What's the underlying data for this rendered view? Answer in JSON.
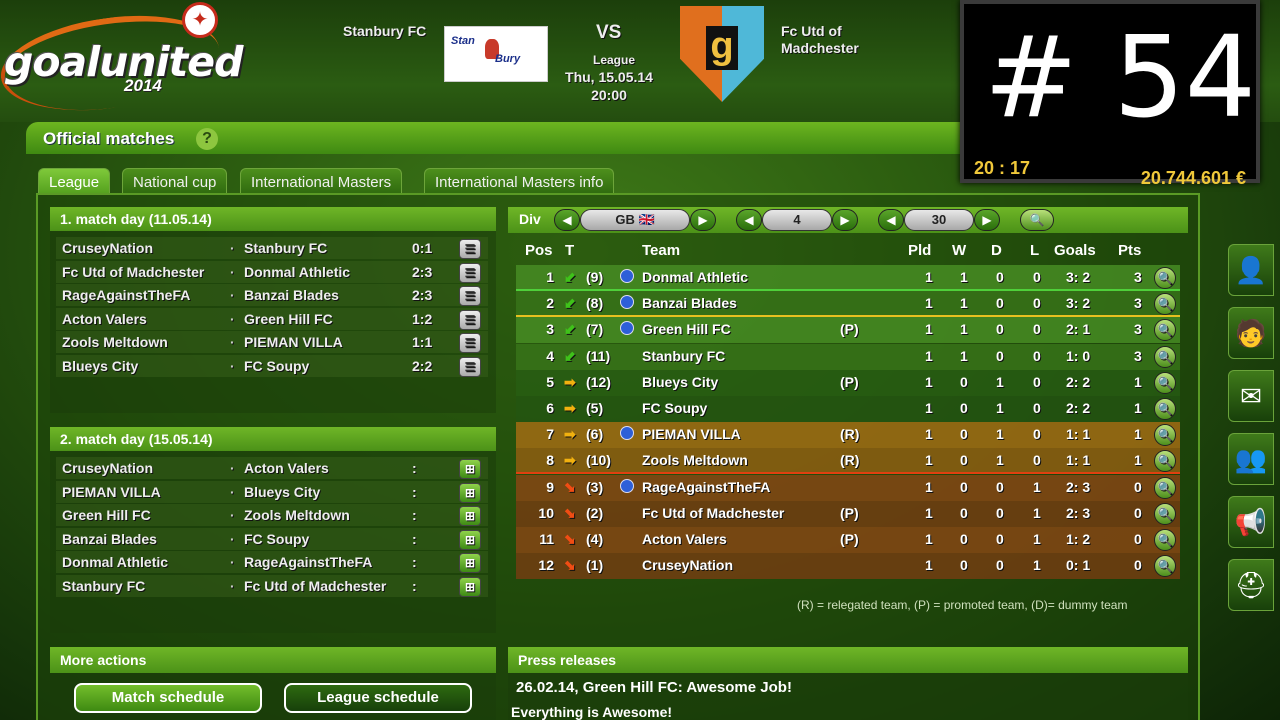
{
  "header": {
    "logo_text": "goalunited",
    "logo_year": "2014",
    "home_team": "Stanbury FC",
    "home_logo_text_1": "Stan",
    "home_logo_text_2": "Bury",
    "vs": "VS",
    "match_type": "League",
    "match_date": "Thu, 15.05.14",
    "match_time": "20:00",
    "away_team_line1": "Fc Utd of",
    "away_team_line2": "Madchester",
    "away_badge_letter": "g"
  },
  "overlay": {
    "episode": "# 54",
    "clock": "20 : 17",
    "money": "20.744.601 €"
  },
  "section_title": "Official matches",
  "help": "?",
  "tabs": [
    "League",
    "National cup",
    "International Masters",
    "International Masters info"
  ],
  "matchday1": {
    "title": "1. match day (11.05.14)",
    "matches": [
      {
        "home": "CruseyNation",
        "away": "Stanbury FC",
        "score": "0:1"
      },
      {
        "home": "Fc Utd of Madchester",
        "away": "Donmal Athletic",
        "score": "2:3"
      },
      {
        "home": "RageAgainstTheFA",
        "away": "Banzai Blades",
        "score": "2:3"
      },
      {
        "home": "Acton Valers",
        "away": "Green Hill FC",
        "score": "1:2"
      },
      {
        "home": "Zools Meltdown",
        "away": "PIEMAN VILLA",
        "score": "1:1"
      },
      {
        "home": "Blueys City",
        "away": "FC Soupy",
        "score": "2:2"
      }
    ]
  },
  "matchday2": {
    "title": "2. match day (15.05.14)",
    "matches": [
      {
        "home": "CruseyNation",
        "away": "Acton Valers",
        "score": ":"
      },
      {
        "home": "PIEMAN VILLA",
        "away": "Blueys City",
        "score": ":"
      },
      {
        "home": "Green Hill FC",
        "away": "Zools Meltdown",
        "score": ":"
      },
      {
        "home": "Banzai Blades",
        "away": "FC Soupy",
        "score": ":"
      },
      {
        "home": "Donmal Athletic",
        "away": "RageAgainstTheFA",
        "score": ":"
      },
      {
        "home": "Stanbury FC",
        "away": "Fc Utd of Madchester",
        "score": ":"
      }
    ]
  },
  "table_controls": {
    "div_label": "Div",
    "country": "GB",
    "flag": "🇬🇧",
    "division": "4",
    "league": "30"
  },
  "table_headers": {
    "pos": "Pos",
    "t": "T",
    "team": "Team",
    "pld": "Pld",
    "w": "W",
    "d": "D",
    "l": "L",
    "goals": "Goals",
    "pts": "Pts"
  },
  "standings": [
    {
      "pos": "1",
      "trend": "up",
      "prev": "(9)",
      "flag": true,
      "team": "Donmal Athletic",
      "mark": "",
      "pld": "1",
      "w": "1",
      "d": "0",
      "l": "0",
      "goals": "3: 2",
      "pts": "3"
    },
    {
      "pos": "2",
      "trend": "up",
      "prev": "(8)",
      "flag": true,
      "team": "Banzai Blades",
      "mark": "",
      "pld": "1",
      "w": "1",
      "d": "0",
      "l": "0",
      "goals": "3: 2",
      "pts": "3"
    },
    {
      "pos": "3",
      "trend": "up",
      "prev": "(7)",
      "flag": true,
      "team": "Green Hill FC",
      "mark": "(P)",
      "pld": "1",
      "w": "1",
      "d": "0",
      "l": "0",
      "goals": "2: 1",
      "pts": "3"
    },
    {
      "pos": "4",
      "trend": "up",
      "prev": "(11)",
      "flag": false,
      "team": "Stanbury FC",
      "mark": "",
      "pld": "1",
      "w": "1",
      "d": "0",
      "l": "0",
      "goals": "1: 0",
      "pts": "3"
    },
    {
      "pos": "5",
      "trend": "same",
      "prev": "(12)",
      "flag": false,
      "team": "Blueys City",
      "mark": "(P)",
      "pld": "1",
      "w": "0",
      "d": "1",
      "l": "0",
      "goals": "2: 2",
      "pts": "1"
    },
    {
      "pos": "6",
      "trend": "same",
      "prev": "(5)",
      "flag": false,
      "team": "FC Soupy",
      "mark": "",
      "pld": "1",
      "w": "0",
      "d": "1",
      "l": "0",
      "goals": "2: 2",
      "pts": "1"
    },
    {
      "pos": "7",
      "trend": "same",
      "prev": "(6)",
      "flag": true,
      "team": "PIEMAN VILLA",
      "mark": "(R)",
      "pld": "1",
      "w": "0",
      "d": "1",
      "l": "0",
      "goals": "1: 1",
      "pts": "1"
    },
    {
      "pos": "8",
      "trend": "same",
      "prev": "(10)",
      "flag": false,
      "team": "Zools Meltdown",
      "mark": "(R)",
      "pld": "1",
      "w": "0",
      "d": "1",
      "l": "0",
      "goals": "1: 1",
      "pts": "1"
    },
    {
      "pos": "9",
      "trend": "down",
      "prev": "(3)",
      "flag": true,
      "team": "RageAgainstTheFA",
      "mark": "",
      "pld": "1",
      "w": "0",
      "d": "0",
      "l": "1",
      "goals": "2: 3",
      "pts": "0"
    },
    {
      "pos": "10",
      "trend": "down",
      "prev": "(2)",
      "flag": false,
      "team": "Fc Utd of Madchester",
      "mark": "(P)",
      "pld": "1",
      "w": "0",
      "d": "0",
      "l": "1",
      "goals": "2: 3",
      "pts": "0"
    },
    {
      "pos": "11",
      "trend": "down",
      "prev": "(4)",
      "flag": false,
      "team": "Acton Valers",
      "mark": "(P)",
      "pld": "1",
      "w": "0",
      "d": "0",
      "l": "1",
      "goals": "1: 2",
      "pts": "0"
    },
    {
      "pos": "12",
      "trend": "down",
      "prev": "(1)",
      "flag": false,
      "team": "CruseyNation",
      "mark": "",
      "pld": "1",
      "w": "0",
      "d": "0",
      "l": "1",
      "goals": "0: 1",
      "pts": "0"
    }
  ],
  "legend": "(R) = relegated team, (P) = promoted team, (D)= dummy team",
  "more_actions": {
    "title": "More actions",
    "match_schedule": "Match schedule",
    "league_schedule": "League schedule"
  },
  "press": {
    "title": "Press releases",
    "headline": "26.02.14, Green Hill FC: Awesome Job!",
    "body": "Everything is Awesome!"
  },
  "sidebar": [
    "user-favorite-icon",
    "manager-icon",
    "mail-icon",
    "team-chat-icon",
    "megaphone-icon",
    "lifebuoy-icon"
  ],
  "colors": {
    "accent_green": "#6fb627",
    "promotion_row": "#3f8a1d",
    "relegation_row": "#8a4a14",
    "gold_text": "#f0c83a"
  }
}
